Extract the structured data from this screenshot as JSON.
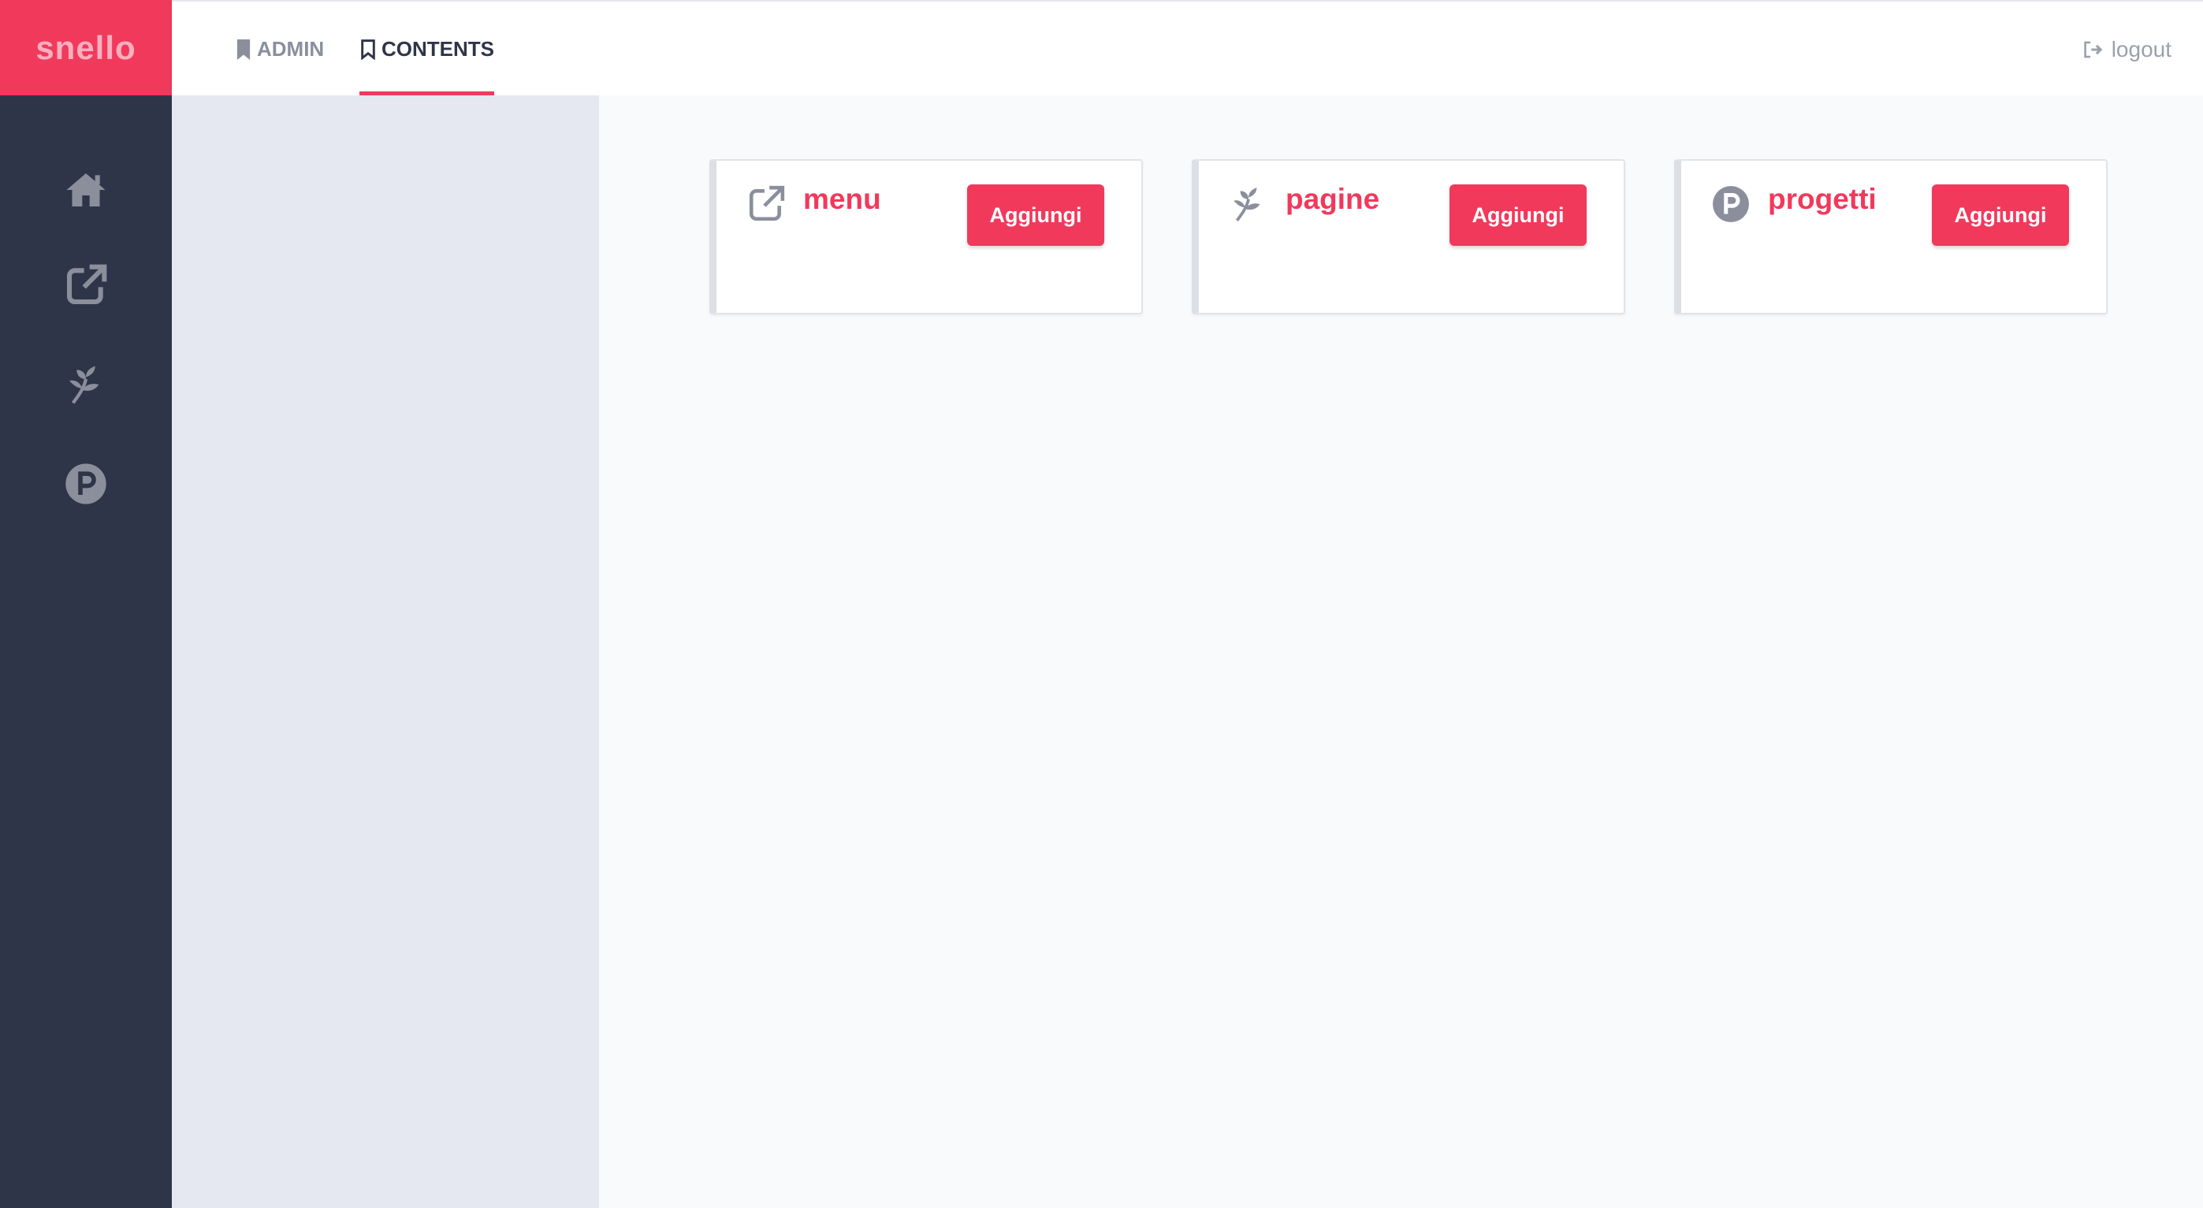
{
  "brand": {
    "logo_text": "snello"
  },
  "topbar": {
    "tabs": [
      {
        "label": "ADMIN",
        "icon": "bookmark-filled-icon",
        "active": false
      },
      {
        "label": "CONTENTS",
        "icon": "bookmark-outline-icon",
        "active": true
      }
    ],
    "logout": {
      "label": "logout",
      "icon": "sign-out-icon"
    }
  },
  "sidebar": {
    "items": [
      {
        "icon": "home-icon"
      },
      {
        "icon": "external-link-icon"
      },
      {
        "icon": "pagelines-icon"
      },
      {
        "icon": "product-hunt-icon"
      }
    ]
  },
  "cards": [
    {
      "title": "menu",
      "icon": "external-link-icon",
      "button": "Aggiungi"
    },
    {
      "title": "pagine",
      "icon": "pagelines-icon",
      "button": "Aggiungi"
    },
    {
      "title": "progetti",
      "icon": "product-hunt-icon",
      "button": "Aggiungi"
    }
  ],
  "colors": {
    "accent": "#f1395c",
    "sidebar_bg": "#2f3548",
    "subpanel_bg": "#e5e8f1",
    "main_bg": "#f9fafc",
    "icon_gray": "#8b8f9c"
  }
}
